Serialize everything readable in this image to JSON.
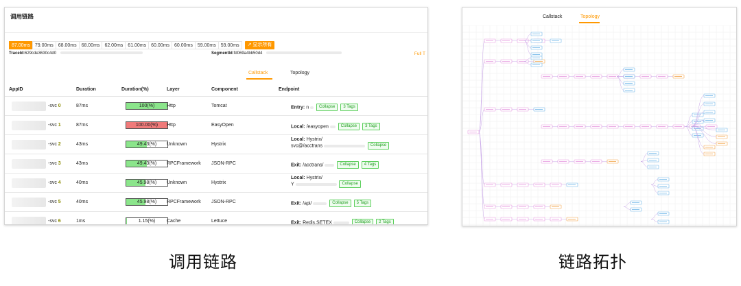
{
  "left": {
    "title": "调用链路",
    "durations": [
      "87.00ms",
      "79.00ms",
      "68.00ms",
      "68.00ms",
      "62.00ms",
      "61.00ms",
      "60.00ms",
      "60.00ms",
      "59.00ms",
      "59.00ms"
    ],
    "active_duration_index": 0,
    "show_all_label": "↗ 显示所有",
    "trace_label": "TraceId:",
    "trace_value": "629cde3630c4d0",
    "segment_label": "SegmentId:",
    "segment_value": "fd069a4bb50d4",
    "full_label": "Full T",
    "tabs": {
      "callstack": "Callstack",
      "topology": "Topology",
      "active": "Callstack"
    },
    "columns": [
      "AppID",
      "Duration",
      "Duration(%)",
      "Layer",
      "Component",
      "Endpoint"
    ],
    "rows": [
      {
        "svc": "-svc",
        "num": "0",
        "duration": "87ms",
        "percent": "100(%)",
        "fill": 1.0,
        "error": false,
        "layer": "Http",
        "component": "Tomcat",
        "ep_bold": "Entry:",
        "ep_text": "n",
        "ep_line2": "",
        "collapse": "Collapse",
        "tags": "3 Tags"
      },
      {
        "svc": "-svc",
        "num": "1",
        "duration": "87ms",
        "percent": "100.00(%)",
        "fill": 1.0,
        "error": true,
        "layer": "Http",
        "component": "EasyOpen",
        "ep_bold": "Local:",
        "ep_text": "/easyopen",
        "ep_line2": "",
        "collapse": "Collapse",
        "tags": "3 Tags"
      },
      {
        "svc": "-svc",
        "num": "2",
        "duration": "43ms",
        "percent": "49.43(%)",
        "fill": 0.4943,
        "error": false,
        "layer": "Unknown",
        "component": "Hystrix",
        "ep_bold": "Local:",
        "ep_text": "Hystrix/",
        "ep_line2": "svc@/acctrans",
        "collapse": "Collapse",
        "tags": ""
      },
      {
        "svc": "-svc",
        "num": "3",
        "duration": "43ms",
        "percent": "49.43(%)",
        "fill": 0.4943,
        "error": false,
        "layer": "RPCFramework",
        "component": "JSON-RPC",
        "ep_bold": "Exit:",
        "ep_text": "/acctrans/",
        "ep_line2": "",
        "collapse": "Collapse",
        "tags": "4 Tags"
      },
      {
        "svc": "-svc",
        "num": "4",
        "duration": "40ms",
        "percent": "45.98(%)",
        "fill": 0.4598,
        "error": false,
        "layer": "Unknown",
        "component": "Hystrix",
        "ep_bold": "Local:",
        "ep_text": "Hystrix/",
        "ep_line2": "Y",
        "collapse": "Collapse",
        "tags": ""
      },
      {
        "svc": "-svc",
        "num": "5",
        "duration": "40ms",
        "percent": "45.98(%)",
        "fill": 0.4598,
        "error": false,
        "layer": "RPCFramework",
        "component": "JSON-RPC",
        "ep_bold": "Exit:",
        "ep_text": "/api/",
        "ep_line2": "",
        "collapse": "Collapse",
        "tags": "5 Tags"
      },
      {
        "svc": "-svc",
        "num": "6",
        "duration": "1ms",
        "percent": "1.15(%)",
        "fill": 0.0115,
        "error": false,
        "layer": "Cache",
        "component": "Lettuce",
        "ep_bold": "Exit:",
        "ep_text": "Redis.SETEX",
        "ep_line2": "",
        "collapse": "Collapse",
        "tags": "2 Tags"
      }
    ]
  },
  "right": {
    "tabs": {
      "callstack": "Callstack",
      "topology": "Topology",
      "active": "Topology"
    }
  },
  "captions": {
    "left": "调用链路",
    "right": "链路拓扑"
  },
  "colors": {
    "accent": "#ff9800",
    "bar_ok": "#8be58b",
    "bar_err": "#f07a7a",
    "tag_green": "#1e9e1e"
  }
}
